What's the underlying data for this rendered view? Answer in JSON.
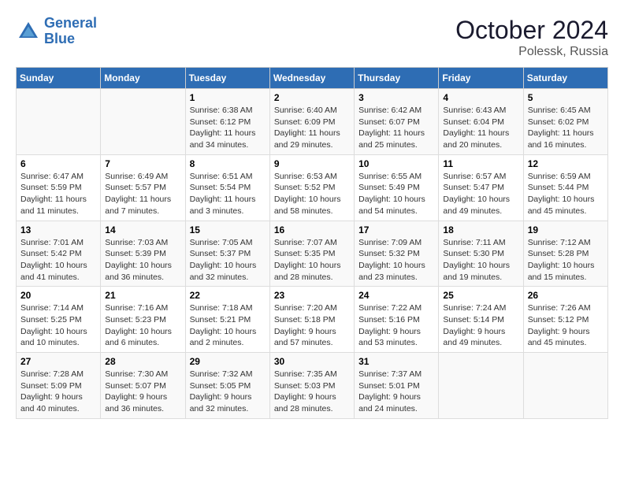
{
  "logo": {
    "line1": "General",
    "line2": "Blue"
  },
  "title": "October 2024",
  "location": "Polessk, Russia",
  "headers": [
    "Sunday",
    "Monday",
    "Tuesday",
    "Wednesday",
    "Thursday",
    "Friday",
    "Saturday"
  ],
  "weeks": [
    [
      {
        "day": "",
        "info": ""
      },
      {
        "day": "",
        "info": ""
      },
      {
        "day": "1",
        "info": "Sunrise: 6:38 AM\nSunset: 6:12 PM\nDaylight: 11 hours\nand 34 minutes."
      },
      {
        "day": "2",
        "info": "Sunrise: 6:40 AM\nSunset: 6:09 PM\nDaylight: 11 hours\nand 29 minutes."
      },
      {
        "day": "3",
        "info": "Sunrise: 6:42 AM\nSunset: 6:07 PM\nDaylight: 11 hours\nand 25 minutes."
      },
      {
        "day": "4",
        "info": "Sunrise: 6:43 AM\nSunset: 6:04 PM\nDaylight: 11 hours\nand 20 minutes."
      },
      {
        "day": "5",
        "info": "Sunrise: 6:45 AM\nSunset: 6:02 PM\nDaylight: 11 hours\nand 16 minutes."
      }
    ],
    [
      {
        "day": "6",
        "info": "Sunrise: 6:47 AM\nSunset: 5:59 PM\nDaylight: 11 hours\nand 11 minutes."
      },
      {
        "day": "7",
        "info": "Sunrise: 6:49 AM\nSunset: 5:57 PM\nDaylight: 11 hours\nand 7 minutes."
      },
      {
        "day": "8",
        "info": "Sunrise: 6:51 AM\nSunset: 5:54 PM\nDaylight: 11 hours\nand 3 minutes."
      },
      {
        "day": "9",
        "info": "Sunrise: 6:53 AM\nSunset: 5:52 PM\nDaylight: 10 hours\nand 58 minutes."
      },
      {
        "day": "10",
        "info": "Sunrise: 6:55 AM\nSunset: 5:49 PM\nDaylight: 10 hours\nand 54 minutes."
      },
      {
        "day": "11",
        "info": "Sunrise: 6:57 AM\nSunset: 5:47 PM\nDaylight: 10 hours\nand 49 minutes."
      },
      {
        "day": "12",
        "info": "Sunrise: 6:59 AM\nSunset: 5:44 PM\nDaylight: 10 hours\nand 45 minutes."
      }
    ],
    [
      {
        "day": "13",
        "info": "Sunrise: 7:01 AM\nSunset: 5:42 PM\nDaylight: 10 hours\nand 41 minutes."
      },
      {
        "day": "14",
        "info": "Sunrise: 7:03 AM\nSunset: 5:39 PM\nDaylight: 10 hours\nand 36 minutes."
      },
      {
        "day": "15",
        "info": "Sunrise: 7:05 AM\nSunset: 5:37 PM\nDaylight: 10 hours\nand 32 minutes."
      },
      {
        "day": "16",
        "info": "Sunrise: 7:07 AM\nSunset: 5:35 PM\nDaylight: 10 hours\nand 28 minutes."
      },
      {
        "day": "17",
        "info": "Sunrise: 7:09 AM\nSunset: 5:32 PM\nDaylight: 10 hours\nand 23 minutes."
      },
      {
        "day": "18",
        "info": "Sunrise: 7:11 AM\nSunset: 5:30 PM\nDaylight: 10 hours\nand 19 minutes."
      },
      {
        "day": "19",
        "info": "Sunrise: 7:12 AM\nSunset: 5:28 PM\nDaylight: 10 hours\nand 15 minutes."
      }
    ],
    [
      {
        "day": "20",
        "info": "Sunrise: 7:14 AM\nSunset: 5:25 PM\nDaylight: 10 hours\nand 10 minutes."
      },
      {
        "day": "21",
        "info": "Sunrise: 7:16 AM\nSunset: 5:23 PM\nDaylight: 10 hours\nand 6 minutes."
      },
      {
        "day": "22",
        "info": "Sunrise: 7:18 AM\nSunset: 5:21 PM\nDaylight: 10 hours\nand 2 minutes."
      },
      {
        "day": "23",
        "info": "Sunrise: 7:20 AM\nSunset: 5:18 PM\nDaylight: 9 hours\nand 57 minutes."
      },
      {
        "day": "24",
        "info": "Sunrise: 7:22 AM\nSunset: 5:16 PM\nDaylight: 9 hours\nand 53 minutes."
      },
      {
        "day": "25",
        "info": "Sunrise: 7:24 AM\nSunset: 5:14 PM\nDaylight: 9 hours\nand 49 minutes."
      },
      {
        "day": "26",
        "info": "Sunrise: 7:26 AM\nSunset: 5:12 PM\nDaylight: 9 hours\nand 45 minutes."
      }
    ],
    [
      {
        "day": "27",
        "info": "Sunrise: 7:28 AM\nSunset: 5:09 PM\nDaylight: 9 hours\nand 40 minutes."
      },
      {
        "day": "28",
        "info": "Sunrise: 7:30 AM\nSunset: 5:07 PM\nDaylight: 9 hours\nand 36 minutes."
      },
      {
        "day": "29",
        "info": "Sunrise: 7:32 AM\nSunset: 5:05 PM\nDaylight: 9 hours\nand 32 minutes."
      },
      {
        "day": "30",
        "info": "Sunrise: 7:35 AM\nSunset: 5:03 PM\nDaylight: 9 hours\nand 28 minutes."
      },
      {
        "day": "31",
        "info": "Sunrise: 7:37 AM\nSunset: 5:01 PM\nDaylight: 9 hours\nand 24 minutes."
      },
      {
        "day": "",
        "info": ""
      },
      {
        "day": "",
        "info": ""
      }
    ]
  ]
}
